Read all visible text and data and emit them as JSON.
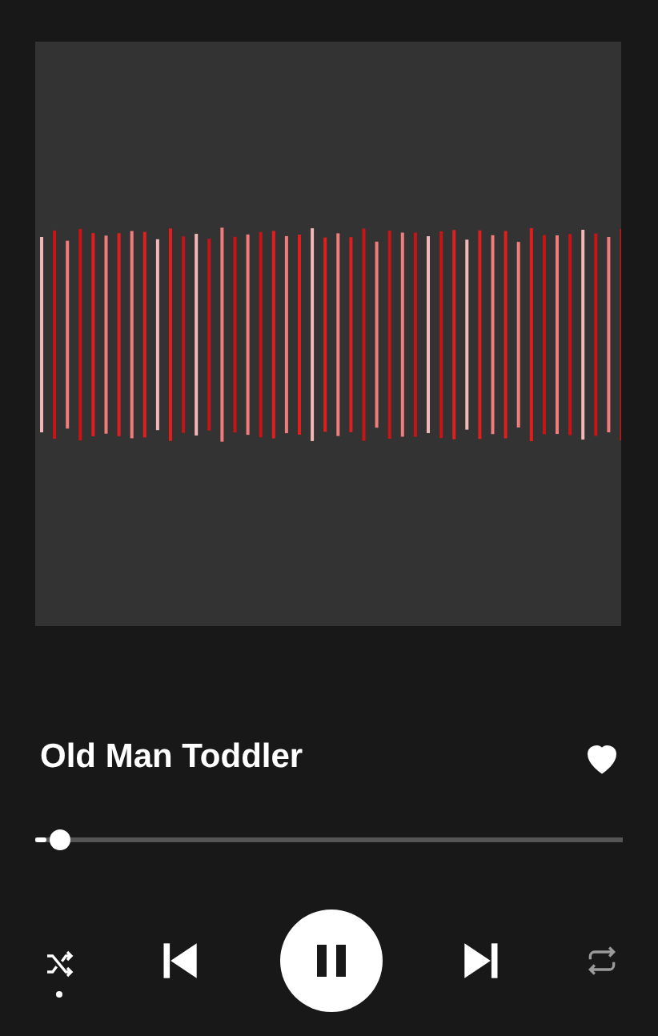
{
  "track": {
    "title": "Old Man Toddler",
    "liked": true
  },
  "progress": {
    "level": 0.02
  },
  "controls": {
    "shuffle_on": true,
    "playing": true,
    "repeat_on": false
  }
}
